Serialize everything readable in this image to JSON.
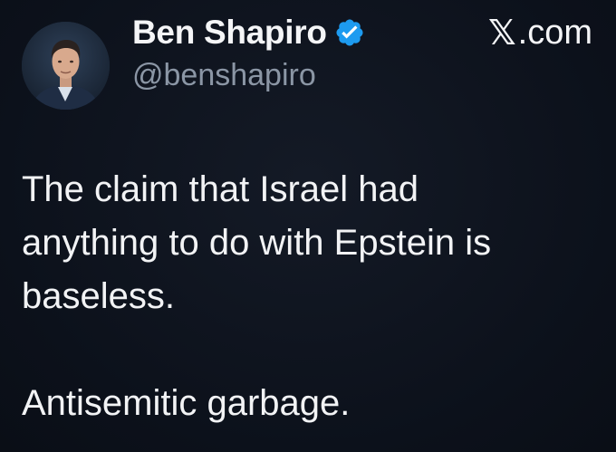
{
  "author": {
    "display_name": "Ben Shapiro",
    "handle": "@benshapiro",
    "verified": true,
    "avatar_icon": "profile-photo"
  },
  "source": {
    "x_mark": "𝕏",
    "domain": ".com"
  },
  "tweet": {
    "lines": [
      "The claim that Israel had",
      "anything to do with Epstein is",
      "baseless.",
      "Antisemitic garbage."
    ]
  },
  "colors": {
    "background": "#0c111b",
    "text": "#f2f3f5",
    "handle": "#8b96a5",
    "verified_badge": "#1d9bf0"
  }
}
